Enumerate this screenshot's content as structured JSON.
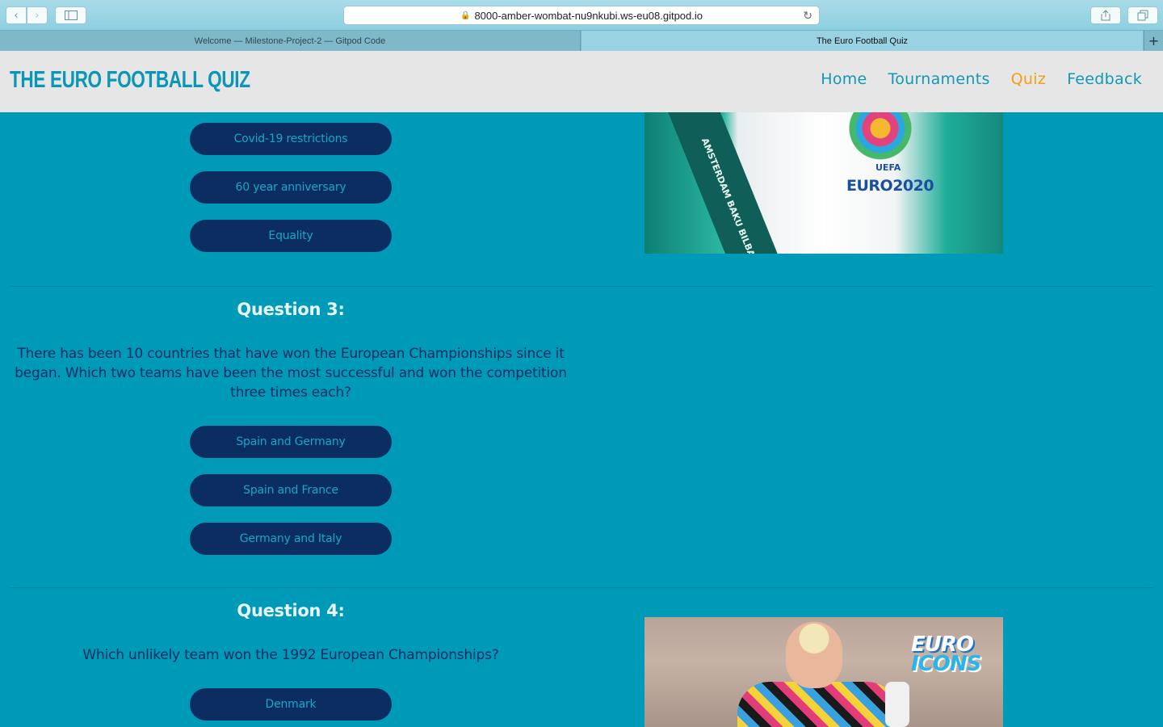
{
  "browser": {
    "url": "8000-amber-wombat-nu9nkubi.ws-eu08.gitpod.io",
    "tabs": [
      {
        "label": "Welcome — Milestone-Project-2 — Gitpod Code"
      },
      {
        "label": "The Euro Football Quiz"
      }
    ]
  },
  "site": {
    "logo": "THE EURO FOOTBALL QUIZ",
    "nav": [
      {
        "label": "Home"
      },
      {
        "label": "Tournaments"
      },
      {
        "label": "Quiz",
        "active": true
      },
      {
        "label": "Feedback"
      }
    ],
    "accent_color": "#f2a012",
    "background_color": "#009ab9"
  },
  "quiz": {
    "question2_answers": [
      {
        "label": "Covid-19 restrictions"
      },
      {
        "label": "60 year anniversary"
      },
      {
        "label": "Equality"
      }
    ],
    "question3": {
      "title": "Question 3:",
      "text": "There has been 10 countries that have won the European Championships since it began. Which two teams have been the most successful and won the competition three times each?",
      "answers": [
        {
          "label": "Spain and Germany"
        },
        {
          "label": "Spain and France"
        },
        {
          "label": "Germany and Italy"
        }
      ]
    },
    "question4": {
      "title": "Question 4:",
      "text": "Which unlikely team won the 1992 European Championships?",
      "answers": [
        {
          "label": "Denmark"
        }
      ]
    }
  },
  "images": {
    "ball": {
      "logo_text": "EURO2020",
      "sub_text": "UEFA",
      "band_text": "AMSTERDAM BAKU BILBAO"
    },
    "keeper": {
      "badge_line1": "EURO",
      "badge_line2": "ICONS"
    }
  }
}
